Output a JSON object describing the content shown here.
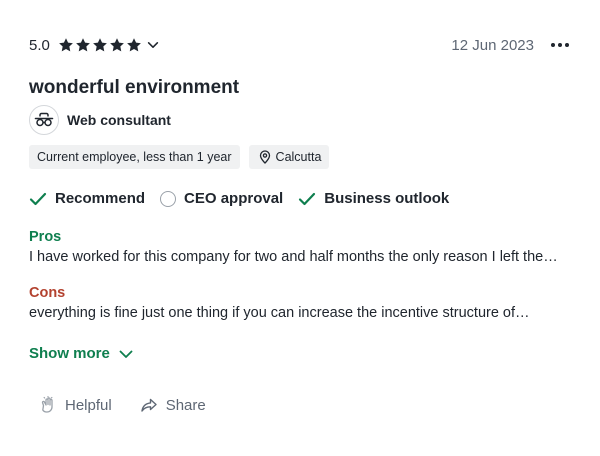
{
  "review": {
    "rating_value": "5.0",
    "rating_stars": 5,
    "date": "12 Jun 2023",
    "title": "wonderful environment",
    "job_title": "Web consultant",
    "employment_tag": "Current employee, less than 1 year",
    "location": "Calcutta",
    "ratings": {
      "recommend": "Recommend",
      "ceo_approval": "CEO approval",
      "business_outlook": "Business outlook"
    },
    "pros_label": "Pros",
    "pros_text": "I have worked for this company for two and half months the only reason I left the…",
    "cons_label": "Cons",
    "cons_text": "everything is fine just one thing if you can increase the incentive structure of…",
    "show_more": "Show more",
    "actions": {
      "helpful": "Helpful",
      "share": "Share"
    }
  },
  "colors": {
    "text": "#20262e",
    "muted": "#5e6774",
    "green": "#0f7f4f",
    "red": "#b3422f",
    "tag_bg": "#f0f1f2"
  },
  "icons": {
    "star": "star-icon",
    "chevron": "chevron-down-icon",
    "more": "more-dots-icon",
    "role": "briefcase-glasses-icon",
    "location": "location-pin-icon",
    "check": "check-icon",
    "empty": "empty-circle-icon",
    "helpful": "clap-hands-icon",
    "share": "share-arrow-icon"
  }
}
